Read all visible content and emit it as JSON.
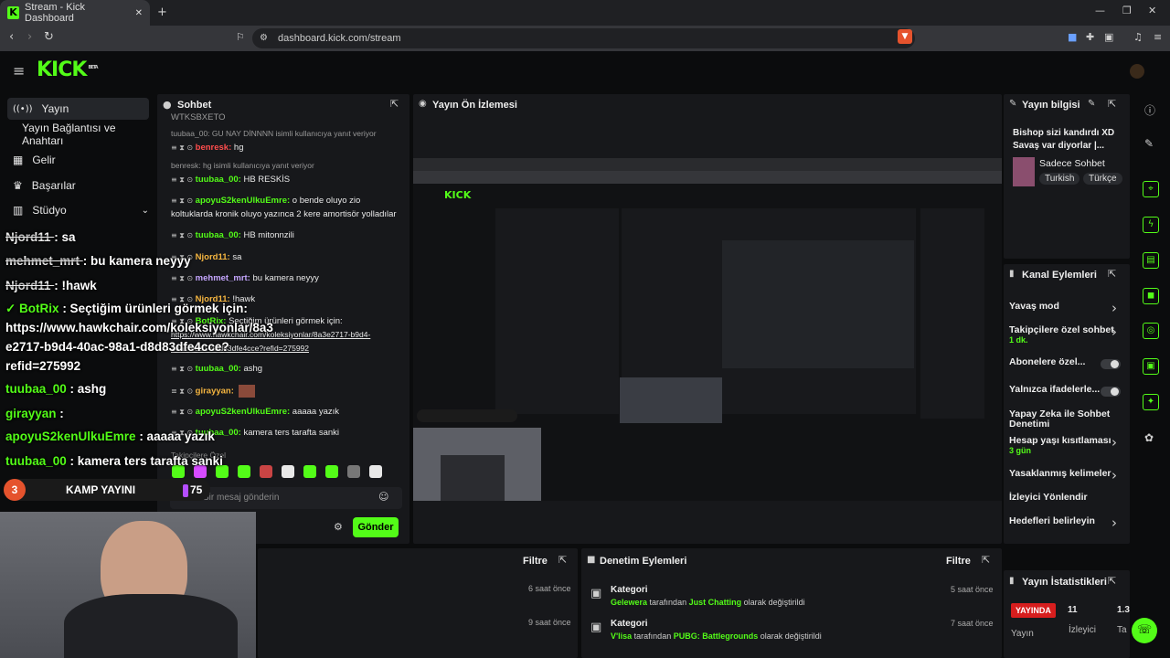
{
  "browser": {
    "tab_title": "Stream - Kick Dashboard",
    "url": "dashboard.kick.com/stream"
  },
  "header": {
    "logo": "KICK",
    "beta": "BETA"
  },
  "sidebar": {
    "items": [
      {
        "label": "Yayın"
      },
      {
        "label": "Yayın Bağlantısı ve Anahtarı"
      },
      {
        "label": "Gelir"
      },
      {
        "label": "Başarılar"
      },
      {
        "label": "Stüdyo"
      }
    ]
  },
  "chat": {
    "title": "Sohbet",
    "placeholder": "Bir mesaj gönderin",
    "send_label": "Gönder",
    "top_fragment": "WTKSBXETO",
    "reply1": "tuubaa_00: GU NAY DİNNNN isimli kullanıcıya yanıt veriyor",
    "reply2": "benresk: hg isimli kullanıcıya yanıt veriyor",
    "messages": [
      {
        "user": "benresk:",
        "text": "hg"
      },
      {
        "user": "tuubaa_00:",
        "text": "HB RESKİS"
      },
      {
        "user": "apoyuS2kenUlkuEmre:",
        "text": "o bende oluyo zio"
      },
      {
        "user": "",
        "text": "koltuklarda kronik oluyo yazınca 2 kere amortisör yolladılar"
      },
      {
        "user": "tuubaa_00:",
        "text": "HB mitonnzili"
      },
      {
        "user": "Njord11:",
        "text": "sa"
      },
      {
        "user": "mehmet_mrt:",
        "text": "bu kamera neyyy"
      },
      {
        "user": "Njord11:",
        "text": "!hawk"
      },
      {
        "user": "BotRix:",
        "text": "Seçtiğim ürünleri görmek için:"
      },
      {
        "user": "",
        "text": "https://www.hawkchair.com/koleksiyonlar/8a3e2717-b9d4-"
      },
      {
        "user": "",
        "text": "40ac-98a1-d8d83dfe4cce?refid=275992"
      },
      {
        "user": "tuubaa_00:",
        "text": "ashg"
      },
      {
        "user": "girayyan:",
        "text": ""
      },
      {
        "user": "apoyuS2kenUlkuEmre:",
        "text": "aaaaa yazık"
      },
      {
        "user": "tuubaa_00:",
        "text": "kamera ters tarafta sanki"
      }
    ],
    "followers_only": "Takipçilere Özel"
  },
  "overlay": {
    "lines": [
      {
        "user": "Njord11",
        "text": ": sa"
      },
      {
        "user": "mehmet_mrt",
        "text": ": bu kamera neyyy"
      },
      {
        "user": "Njord11",
        "text": ": !hawk"
      },
      {
        "user": "BotRix",
        "text": ": Seçtiğim ürünleri görmek için:"
      },
      {
        "user": "",
        "text": "https://www.hawkchair.com/koleksiyonlar/8a3"
      },
      {
        "user": "",
        "text": "e2717-b9d4-40ac-98a1-d8d83dfe4cce?"
      },
      {
        "user": "",
        "text": "refid=275992"
      },
      {
        "user": "tuubaa_00",
        "text": ": ashg"
      },
      {
        "user": "girayyan",
        "text": ":"
      },
      {
        "user": "apoyuS2kenUlkuEmre",
        "text": ": aaaaa yazık"
      },
      {
        "user": "tuubaa_00",
        "text": ": kamera ters tarafta sanki"
      }
    ],
    "partial": "Takipçilere Özel",
    "kamp_num": "3",
    "kamp_label": "KAMP YAYINI",
    "kamp_count": "75"
  },
  "preview": {
    "title": "Yayın Ön İzlemesi"
  },
  "info": {
    "title": "Yayın bilgisi",
    "stream_title": "Bishop sizi kandırdı XD Savaş var diyorlar |...",
    "category": "Sadece Sohbet",
    "tags": [
      "Turkish",
      "Türkçe"
    ]
  },
  "actions": {
    "title": "Kanal Eylemleri",
    "items": [
      {
        "label": "Yavaş mod",
        "sub": ""
      },
      {
        "label": "Takipçilere özel sohbet",
        "sub": "1 dk."
      },
      {
        "label": "Abonelere özel...",
        "sub": ""
      },
      {
        "label": "Yalnızca ifadelerle...",
        "sub": ""
      },
      {
        "label": "Yapay Zeka ile Sohbet Denetimi",
        "sub": ""
      },
      {
        "label": "Hesap yaşı kısıtlaması",
        "sub": "3 gün"
      },
      {
        "label": "Yasaklanmış kelimeler",
        "sub": ""
      },
      {
        "label": "İzleyici Yönlendir",
        "sub": ""
      },
      {
        "label": "Hedefleri belirleyin",
        "sub": ""
      }
    ]
  },
  "stats": {
    "title": "Yayın İstatistikleri",
    "live": "YAYINDA",
    "viewers": "11",
    "viewers_label": "İzleyici",
    "third": "1.3",
    "third_label": "Ta",
    "live_label": "Yayın"
  },
  "activity": {
    "filter_label": "Filtre",
    "rows": [
      {
        "time": "6 saat önce"
      },
      {
        "time": "9 saat önce"
      }
    ]
  },
  "moderation": {
    "title": "Denetim Eylemleri",
    "filter_label": "Filtre",
    "rows": [
      {
        "head": "Kategori",
        "user": "Gelewera",
        "mid": "tarafından",
        "cat": "Just Chatting",
        "tail": "olarak değiştirildi",
        "time": "5 saat önce"
      },
      {
        "head": "Kategori",
        "user": "V'lisa",
        "mid": "tarafından",
        "cat": "PUBG: Battlegrounds",
        "tail": "olarak değiştirildi",
        "time": "7 saat önce"
      }
    ]
  }
}
